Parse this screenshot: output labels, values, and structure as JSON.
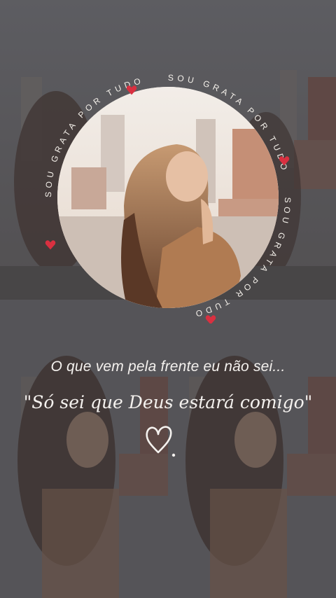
{
  "badge": {
    "ring_text": "SOU GRATA POR TUDO",
    "ring_color": "#f3efe9",
    "heart_color": "#d93040"
  },
  "caption": {
    "line1": "O que vem pela frente eu não sei...",
    "line2": "\"Só sei que Deus estará comigo\""
  },
  "heart_icon": "outline-heart-icon"
}
